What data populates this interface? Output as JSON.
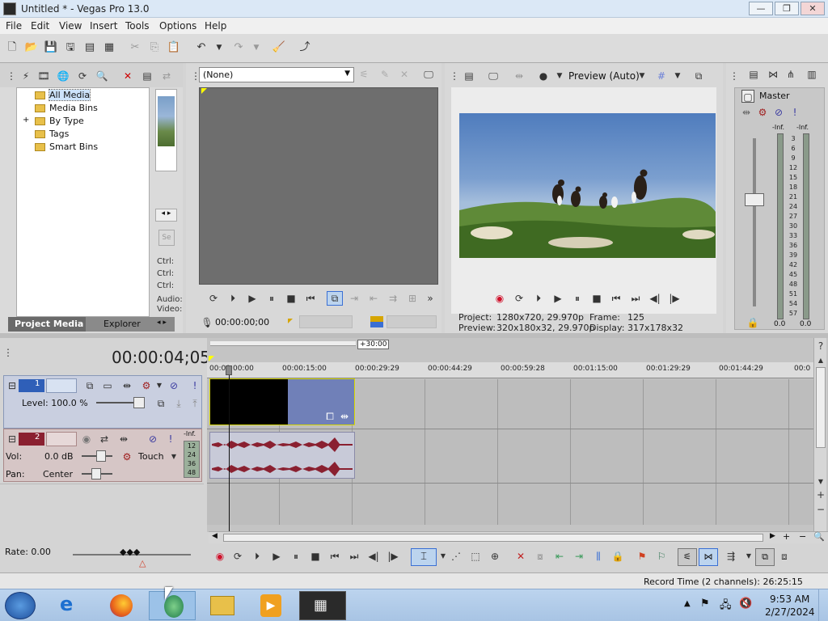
{
  "window": {
    "title": "Untitled * - Vegas Pro 13.0",
    "min": "—",
    "max": "❐",
    "close": "✕"
  },
  "menu": [
    "File",
    "Edit",
    "View",
    "Insert",
    "Tools",
    "Options",
    "Help"
  ],
  "project_media": {
    "tree": [
      "All Media",
      "Media Bins",
      "By Type",
      "Tags",
      "Smart Bins"
    ],
    "expand": "+",
    "tabs": [
      "Project Media",
      "Explorer"
    ],
    "info": [
      "Ctrl:",
      "Ctrl:",
      "Ctrl:",
      "Audio:",
      "Video:"
    ]
  },
  "trimmer": {
    "dropdown": "(None)",
    "time": "00:00:00;00"
  },
  "preview": {
    "mode": "Preview (Auto)",
    "project_label": "Project:",
    "project_value": "1280x720, 29.970p",
    "preview_label": "Preview:",
    "preview_value": "320x180x32, 29.970p",
    "frame_label": "Frame:",
    "frame_value": "125",
    "display_label": "Display:",
    "display_value": "317x178x32"
  },
  "master": {
    "label": "Master",
    "inf_left": "-Inf.",
    "inf_right": "-Inf.",
    "scale": [
      "3",
      "6",
      "9",
      "12",
      "15",
      "18",
      "21",
      "24",
      "27",
      "30",
      "33",
      "36",
      "39",
      "42",
      "45",
      "48",
      "51",
      "54",
      "57"
    ],
    "bottom_left": "0.0",
    "bottom_right": "0.0"
  },
  "timeline": {
    "timecode": "00:00:04;05",
    "offset": "+30:00",
    "ruler": [
      "00:00:00:00",
      "00:00:15:00",
      "00:00:29:29",
      "00:00:44:29",
      "00:00:59:28",
      "00:01:15:00",
      "00:01:29:29",
      "00:01:44:29",
      "00:0"
    ],
    "rate": "Rate: 0.00",
    "record_time": "Record Time (2 channels): 26:25:15"
  },
  "video_track": {
    "number": "1",
    "level": "Level: 100.0 %"
  },
  "audio_track": {
    "number": "2",
    "vol_label": "Vol:",
    "vol_value": "0.0 dB",
    "pan_label": "Pan:",
    "pan_value": "Center",
    "automation": "Touch",
    "meter_inf": "-Inf.",
    "meter_scale": [
      "12",
      "24",
      "36",
      "48"
    ]
  },
  "taskbar": {
    "time": "9:53 AM",
    "date": "2/27/2024"
  },
  "colors": {
    "accent": "#3a6fd4",
    "clip_audio": "#8a2030",
    "track_video": "#2f5fb8",
    "track_audio": "#8a2030"
  }
}
